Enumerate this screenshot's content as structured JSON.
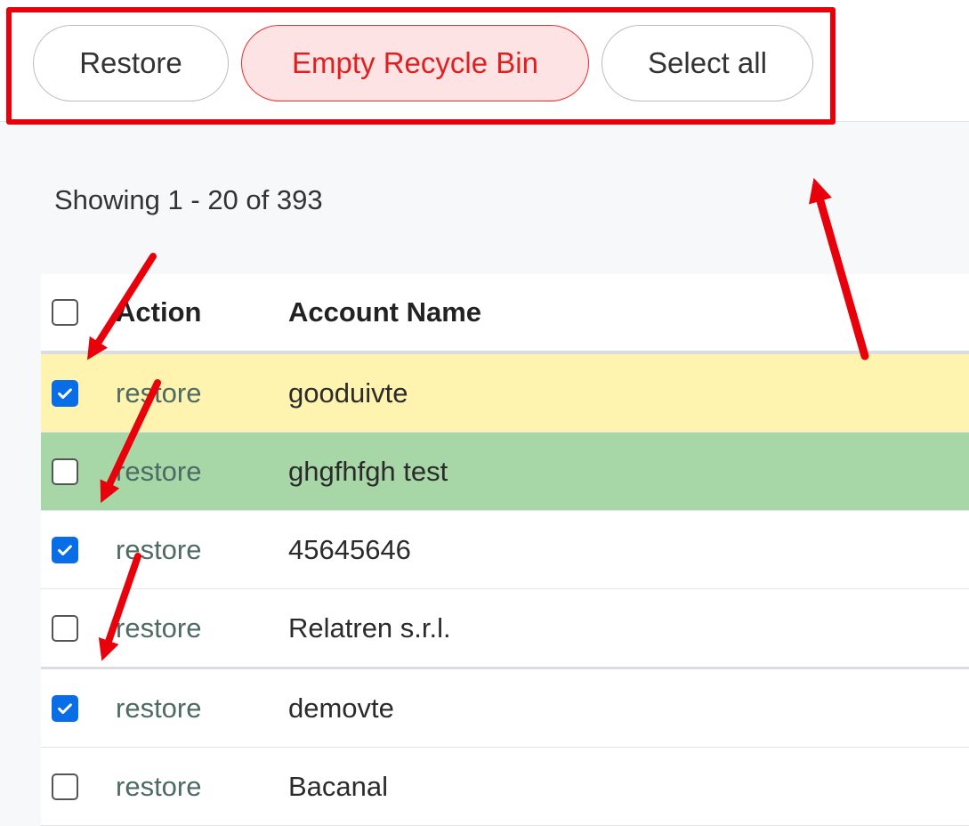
{
  "toolbar": {
    "restore_label": "Restore",
    "empty_label": "Empty Recycle Bin",
    "select_all_label": "Select all"
  },
  "list": {
    "showing_text": "Showing 1 - 20 of 393"
  },
  "table": {
    "columns": [
      "Action",
      "Account Name"
    ],
    "header_checked": false,
    "rows": [
      {
        "checked": true,
        "action": "restore",
        "name": "gooduivte",
        "highlight": "#fff3b0"
      },
      {
        "checked": false,
        "action": "restore",
        "name": "ghgfhfgh test",
        "highlight": "#a7d7a7"
      },
      {
        "checked": true,
        "action": "restore",
        "name": "45645646"
      },
      {
        "checked": false,
        "action": "restore",
        "name": "Relatren s.r.l."
      },
      {
        "checked": true,
        "action": "restore",
        "name": "demovte"
      },
      {
        "checked": false,
        "action": "restore",
        "name": "Bacanal"
      }
    ]
  },
  "colors": {
    "danger": "#e02020",
    "danger_bg": "#fde3e3",
    "checkbox_checked": "#0a6de8",
    "annotation_red": "#e8000a"
  },
  "icons": {
    "checkbox_mark": "check-icon",
    "annotation": "red-arrow-icon"
  }
}
